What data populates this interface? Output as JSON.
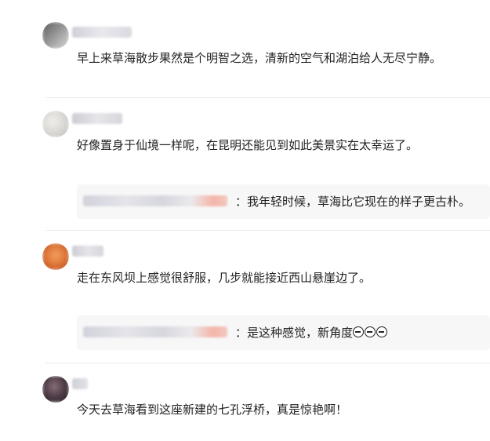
{
  "comments": [
    {
      "text": "早上来草海散步果然是个明智之选，清新的空气和湖泊给人无尽宁静。"
    },
    {
      "text": "好像置身于仙境一样呢，在昆明还能见到如此美景实在太幸运了。",
      "reply": {
        "text": "：我年轻时候，草海比它现在的样子更古朴。"
      }
    },
    {
      "text": "走在东风坝上感觉很舒服，几步就能接近西山悬崖边了。",
      "reply": {
        "text": "：是这种感觉，新角度"
      }
    },
    {
      "text": "今天去草海看到这座新建的七孔浮桥，真是惊艳啊！"
    }
  ],
  "colors": {
    "reply_username": "#d8d8e0",
    "reply_username_accent": "#f4b5a8"
  },
  "icons": {
    "reply_emoji": "grinning-sweat-face-icon",
    "reply_emoji_count": 3
  }
}
